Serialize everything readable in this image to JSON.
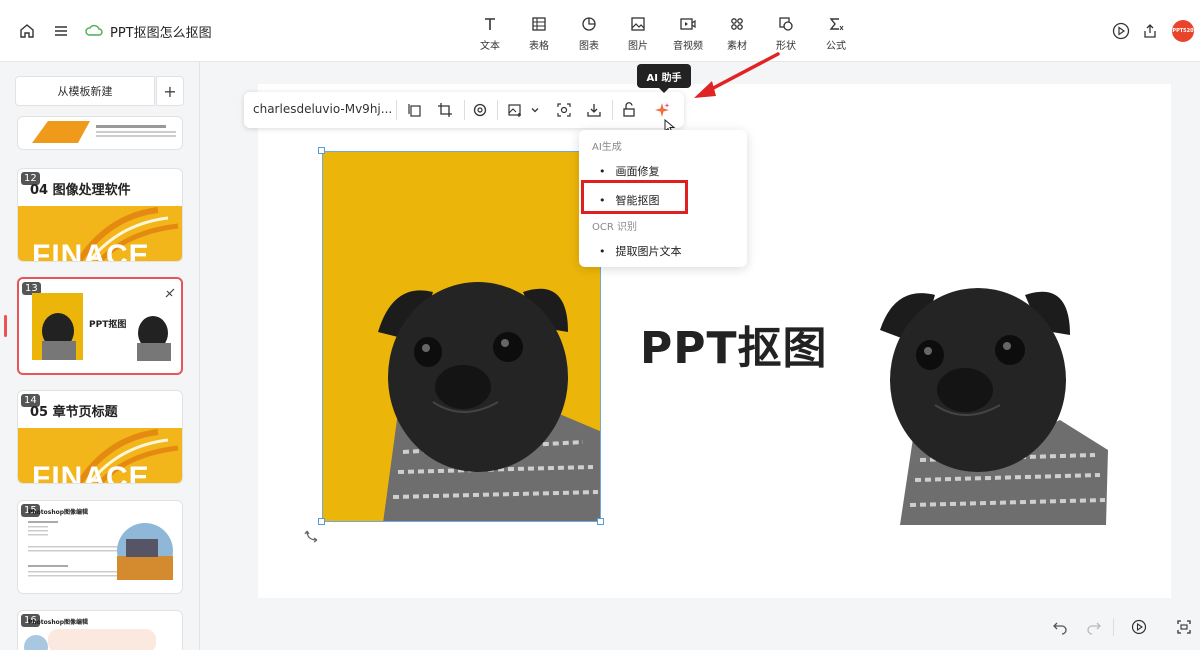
{
  "header": {
    "doc_title": "PPT抠图怎么抠图",
    "tools": [
      {
        "label": "文本",
        "icon": "text-icon"
      },
      {
        "label": "表格",
        "icon": "table-icon"
      },
      {
        "label": "图表",
        "icon": "chart-icon"
      },
      {
        "label": "图片",
        "icon": "image-icon"
      },
      {
        "label": "音视频",
        "icon": "video-icon"
      },
      {
        "label": "素材",
        "icon": "material-icon"
      },
      {
        "label": "形状",
        "icon": "shape-icon"
      },
      {
        "label": "公式",
        "icon": "formula-icon"
      }
    ],
    "avatar_text": "PPT520"
  },
  "sidebar": {
    "new_from_template": "从模板新建",
    "plus": "+",
    "slides": [
      {
        "number": "",
        "title": ""
      },
      {
        "number": "12",
        "title": "04 图像处理软件",
        "banner": "FINACE"
      },
      {
        "number": "13",
        "title": "PPT抠图"
      },
      {
        "number": "14",
        "title": "05 章节页标题",
        "banner": "FINACE"
      },
      {
        "number": "15",
        "title": "Photoshop图像编辑"
      },
      {
        "number": "16",
        "title": "Photoshop图像编辑"
      }
    ]
  },
  "image_toolbar": {
    "image_name": "charlesdeluvio-Mv9hj..."
  },
  "tooltip": "AI 助手",
  "ai_menu": {
    "section_ai": "AI生成",
    "item_repair": "画面修复",
    "item_cutout": "智能抠图",
    "section_ocr": "OCR 识别",
    "item_ocr": "提取图片文本"
  },
  "slide": {
    "title": "PPT抠图"
  },
  "colors": {
    "accent_red": "#e8545a",
    "photo_yellow": "#ecb509",
    "highlight": "#e02020"
  }
}
